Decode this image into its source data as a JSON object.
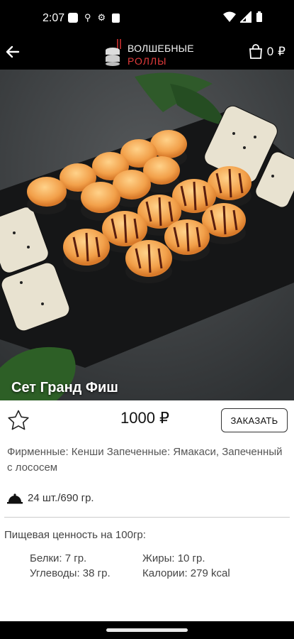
{
  "status_bar": {
    "time": "2:07"
  },
  "header": {
    "logo_line1": "ВОЛШЕБНЫЕ",
    "logo_line2": "РОЛЛЫ",
    "cart_count": "0",
    "cart_currency": "₽"
  },
  "product": {
    "title": "Сет Гранд Фиш",
    "price": "1000 ₽",
    "order_label": "ЗАКАЗАТЬ",
    "description": "Фирменные: Кенши Запеченные: Ямакаси, Запеченный с лососем",
    "weight": "24 шт./690 гр."
  },
  "nutrition": {
    "heading": "Пищевая ценность на 100гр:",
    "proteins": "Белки: 7 гр.",
    "fats": "Жиры: 10 гр.",
    "carbs": "Углеводы: 38 гр.",
    "calories": "Калории: 279 kcal"
  }
}
